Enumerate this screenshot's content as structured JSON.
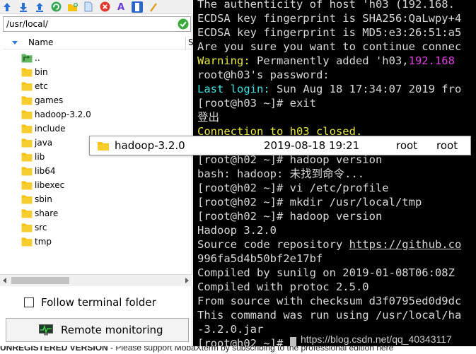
{
  "file_panel": {
    "path": "/usr/local/",
    "column_name": "Name",
    "column_size": "S",
    "items": [
      {
        "name": "..",
        "type": "parent"
      },
      {
        "name": "bin",
        "type": "folder"
      },
      {
        "name": "etc",
        "type": "folder"
      },
      {
        "name": "games",
        "type": "folder"
      },
      {
        "name": "hadoop-3.2.0",
        "type": "folder"
      },
      {
        "name": "include",
        "type": "folder"
      },
      {
        "name": "java",
        "type": "folder"
      },
      {
        "name": "lib",
        "type": "folder"
      },
      {
        "name": "lib64",
        "type": "folder"
      },
      {
        "name": "libexec",
        "type": "folder"
      },
      {
        "name": "sbin",
        "type": "folder"
      },
      {
        "name": "share",
        "type": "folder"
      },
      {
        "name": "src",
        "type": "folder"
      },
      {
        "name": "tmp",
        "type": "folder"
      }
    ],
    "follow_terminal_label": "Follow terminal folder",
    "follow_terminal_checked": false,
    "remote_monitoring_label": "Remote monitoring",
    "toolbar_icons": [
      "up-arrow-icon",
      "download-icon",
      "upload-icon",
      "refresh-icon",
      "new-folder-icon",
      "new-file-icon",
      "delete-icon",
      "rename-icon",
      "clipboard-icon",
      "settings-icon"
    ]
  },
  "drag_ghost": {
    "name": "hadoop-3.2.0",
    "date": "2019-08-18 19:21",
    "owner": "root",
    "group": "root"
  },
  "terminal": {
    "lines": [
      [
        {
          "t": "The authenticity of host 'h03 (192.168.",
          "c": ""
        }
      ],
      [
        {
          "t": "ECDSA key fingerprint is SHA256:QaLwpy+4",
          "c": ""
        }
      ],
      [
        {
          "t": "ECDSA key fingerprint is MD5:e3:26:51:a5",
          "c": ""
        }
      ],
      [
        {
          "t": "Are you sure you want to continue connec",
          "c": ""
        }
      ],
      [
        {
          "t": "Warning:",
          "c": "yellow"
        },
        {
          "t": " Permanently added 'h03,",
          "c": ""
        },
        {
          "t": "192.168",
          "c": "magenta"
        }
      ],
      [
        {
          "t": "root@h03's password:",
          "c": ""
        }
      ],
      [
        {
          "t": "Last login:",
          "c": "cyan"
        },
        {
          "t": " Sun Aug 18 17:34:07 2019 fro",
          "c": ""
        }
      ],
      [
        {
          "t": "[root@h03 ~]# exit",
          "c": ""
        }
      ],
      [
        {
          "t": "登出",
          "c": ""
        }
      ],
      [
        {
          "t": "Connection to h03 closed.",
          "c": "yellow"
        }
      ],
      [
        {
          "t": "",
          "c": ""
        }
      ],
      [
        {
          "t": "[root@h02 ~]# hadoop version",
          "c": ""
        }
      ],
      [
        {
          "t": "bash: hadoop: 未找到命令...",
          "c": ""
        }
      ],
      [
        {
          "t": "[root@h02 ~]# vi /etc/profile",
          "c": ""
        }
      ],
      [
        {
          "t": "[root@h02 ~]# mkdir /usr/local/tmp",
          "c": ""
        }
      ],
      [
        {
          "t": "[root@h02 ~]# hadoop version",
          "c": ""
        }
      ],
      [
        {
          "t": "Hadoop 3.2.0",
          "c": ""
        }
      ],
      [
        {
          "t": "Source code repository ",
          "c": ""
        },
        {
          "t": "https://github.co",
          "c": "under"
        }
      ],
      [
        {
          "t": "996fa5d4b50bf2e17bf",
          "c": ""
        }
      ],
      [
        {
          "t": "Compiled by sunilg on 2019-01-08T06:08Z",
          "c": ""
        }
      ],
      [
        {
          "t": "Compiled with protoc 2.5.0",
          "c": ""
        }
      ],
      [
        {
          "t": "From source with checksum d3f0795ed0d9dc",
          "c": ""
        }
      ],
      [
        {
          "t": "This command was run using /usr/local/ha",
          "c": ""
        }
      ],
      [
        {
          "t": "-3.2.0.jar",
          "c": ""
        }
      ],
      [
        {
          "t": "[root@h02 ~]# ",
          "c": ""
        }
      ]
    ],
    "watermark": "https://blog.csdn.net/qq_40343117"
  },
  "bottom_strip": {
    "left": "UNREGISTERED VERSION",
    "right": " - Please support MobaXterm by subscribing to the professional edition here"
  },
  "colors": {
    "folder": "#f4c20d",
    "terminal_bg": "#000000",
    "terminal_fg": "#d8d8d8",
    "yellow": "#e8e840",
    "cyan": "#42e0e0",
    "magenta": "#e040e0",
    "ok_green": "#3aab3a"
  }
}
